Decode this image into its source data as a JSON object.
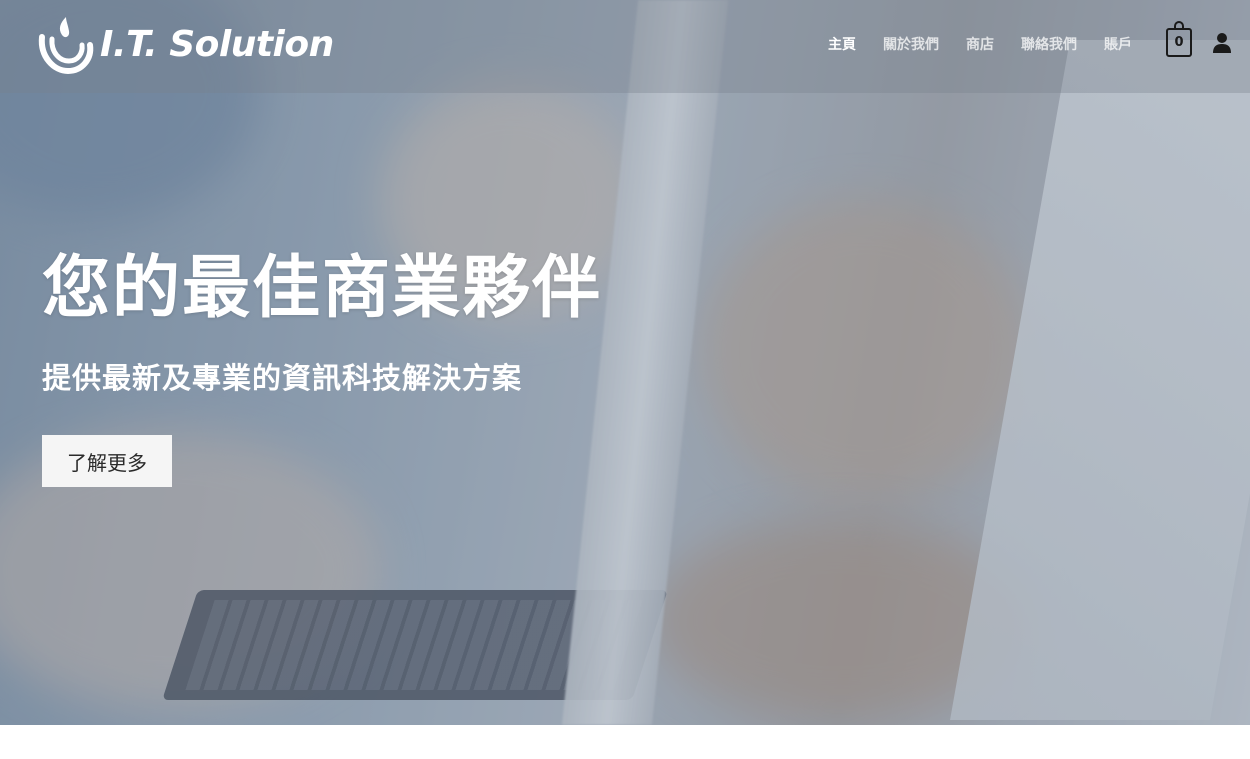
{
  "header": {
    "logo_text": "I.T. Solution",
    "nav": [
      {
        "label": "主頁",
        "active": true
      },
      {
        "label": "關於我們",
        "active": false
      },
      {
        "label": "商店",
        "active": false
      },
      {
        "label": "聯絡我們",
        "active": false
      },
      {
        "label": "賬戶",
        "active": false
      }
    ],
    "cart_count": "0",
    "cart_icon": "shopping-bag-icon",
    "account_icon": "user-icon"
  },
  "hero": {
    "title": "您的最佳商業夥伴",
    "subtitle": "提供最新及專業的資訊科技解決方案",
    "cta_label": "了解更多"
  },
  "colors": {
    "text": "#ffffff",
    "button_bg": "#f5f5f5",
    "icon": "#1a1a1a"
  }
}
